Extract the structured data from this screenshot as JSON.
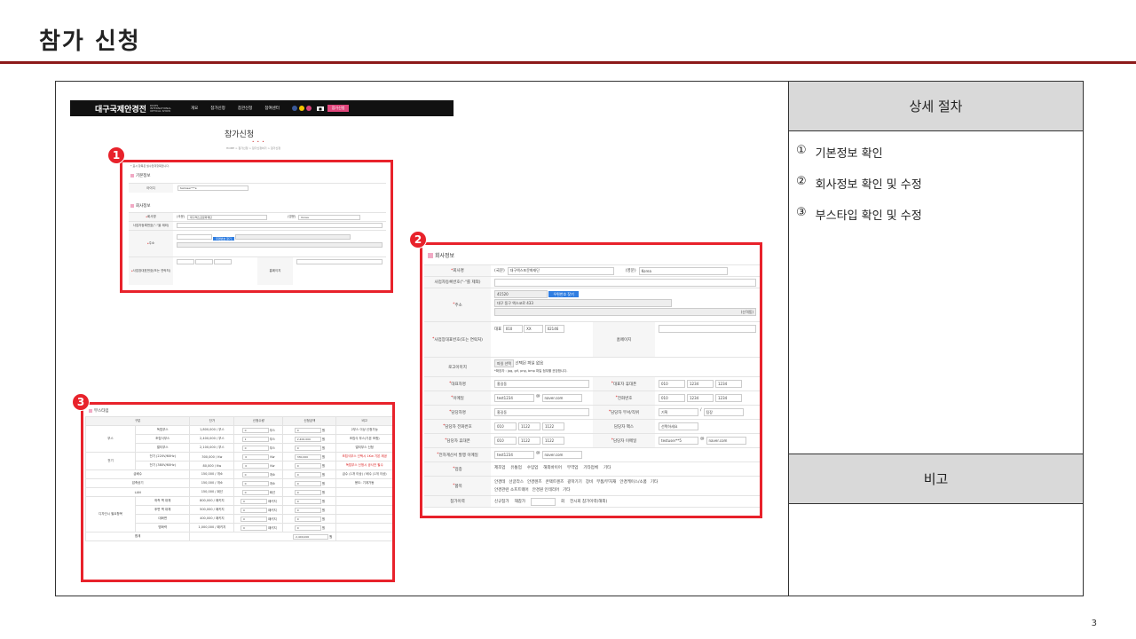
{
  "slide": {
    "title": "참가 신청",
    "page_number": "3"
  },
  "side": {
    "header": "상세 절차",
    "steps": [
      {
        "num": "①",
        "text": "기본정보 확인"
      },
      {
        "num": "②",
        "text": "회사정보 확인 및 수정"
      },
      {
        "num": "③",
        "text": "부스타입 확인 및 수정"
      }
    ],
    "notes_header": "비고"
  },
  "badges": [
    "1",
    "2",
    "3"
  ],
  "site": {
    "logo": "대구국제안경전",
    "logo_sub": "DIOPS INTERNATIONAL OPTICAL SHOW",
    "nav": [
      "개요",
      "참가신청",
      "참관신청",
      "참여센터"
    ],
    "cta": "참가신청",
    "page_heading": "참가신청",
    "dots": "• • •",
    "breadcrumb": "HOME > 참가신청 > 참가신청하기 > 참가신청",
    "note": "* 표시 항목은 필수입력항목입니다."
  },
  "form1": {
    "basic_title": "기본정보",
    "id_label": "아이디",
    "id_value": "testuser***e",
    "company_title": "회사정보",
    "company_label": "회사명",
    "company_ko_prefix": "(국문)",
    "company_ko": "대구엑스포문화재단",
    "company_en_prefix": "(영문)",
    "company_en": "Korea",
    "biz_label": "사업자등록번호(\"-\"을 제외)",
    "addr_label": "주소",
    "addr_btn": "우편번호 찾기",
    "contact_label": "사업장대표번호(또는 연락처)",
    "fax_label": "홈페이지"
  },
  "form2": {
    "title": "회사정보",
    "rows": {
      "company": "회사명",
      "company_ko_prefix": "(국문)",
      "company_ko": "대구엑스포문화재단",
      "company_en_prefix": "(영문)",
      "company_en": "Korea",
      "biz": "사업자등록번호(\"-\"를 제외)",
      "addr": "주소",
      "zip": "41520",
      "addr_btn": "우편번호 찾기",
      "addr1": "대구 동구 엑스코로 433",
      "addr_detail": "(산격동)",
      "contact": "사업장대표번호(또는 연락처)",
      "contact_mobile": "대표",
      "contact_v1": "010",
      "contact_v2": "XX",
      "contact_v3": "02146",
      "homepage": "홈페이지",
      "logo": "로고이미지",
      "logo_btn": "파일 선택",
      "logo_file": "선택된 파일 없음",
      "logo_note": "*확장자 : jpg, gif, png, bmp 파일 첨부를 권장합니다.",
      "ceo": "대표자명",
      "ceo_value": "홍길동",
      "ceo_phone": "대표자 휴대폰",
      "ceo_phone_v": [
        "010",
        "1234",
        "1234"
      ],
      "email": "이메일",
      "email_id": "test1234",
      "email_domain": "naver.com",
      "tel": "전화번호",
      "tel_v": [
        "010",
        "1234",
        "1234"
      ],
      "manager": "담당자명",
      "manager_v": "홍길동",
      "manager_dept": "담당자 부서/직위",
      "manager_dept_v": [
        "기획",
        "팀장"
      ],
      "manager_tel": "담당자 전화번호",
      "manager_tel_v": [
        "010",
        "1122",
        "1122"
      ],
      "manager_fax": "담당자 팩스",
      "manager_fax_v": "선택하세요",
      "manager_mobile": "담당자 휴대폰",
      "manager_mobile_v": [
        "010",
        "1122",
        "1122"
      ],
      "manager_email": "담당자 이메일",
      "manager_email_id": "testuser**5",
      "manager_email_domain": "naver.com",
      "tax_email": "전자계산서 발행 이메일",
      "tax_email_id": "test1234",
      "tax_email_domain": "naver.com",
      "category": "업종",
      "category_opts": [
        "제조업",
        "유통업",
        "수입업",
        "해외바이어",
        "무역업",
        "기타업체",
        "기타"
      ],
      "items": "품목",
      "items_opts": [
        "안경테",
        "선글라스",
        "안경렌즈",
        "콘택트렌즈",
        "광학기기",
        "장비",
        "부품/부자재",
        "안경케이스/소품",
        "기타"
      ],
      "items_opts2": [
        "안경관련 소프트웨어",
        "안경원 인테리어",
        "기타"
      ],
      "exhibit": "참가이력",
      "exhibit_opts": [
        "신규참가",
        "재참가",
        "회",
        "전시회 참가이력(해외)"
      ]
    }
  },
  "booth": {
    "title": "부스타입",
    "headers": [
      "구분",
      "단가",
      "신청수량",
      "신청금액",
      "비고"
    ],
    "rows": [
      {
        "group": "부스",
        "name": "독립부스",
        "price": "1,800,000 / 부스",
        "qty": "0",
        "unit": "부스",
        "amount": "0",
        "note": "2부스 이상 신청가능"
      },
      {
        "group": "",
        "name": "조립식부스",
        "price": "2,400,000 / 부스",
        "qty": "1",
        "unit": "부스",
        "amount": "2,400,000",
        "note": "조립식 부스(기본 포함)"
      },
      {
        "group": "",
        "name": "멀티부스",
        "price": "2,100,000 / 부스",
        "qty": "0",
        "unit": "부스",
        "amount": "0",
        "note": "멀티부스 신청"
      },
      {
        "group": "전기",
        "name": "전기 (220V/60Hz)",
        "price": "300,000 / Kw",
        "qty": "0",
        "unit": "Kw",
        "amount": "330,000",
        "note": "조립식부스 선택시 1Kw 기본 제공"
      },
      {
        "group": "",
        "name": "전기 (380V/60Hz)",
        "price": "80,000 / Kw",
        "qty": "0",
        "unit": "Kw",
        "amount": "0",
        "note": "독립부스 신청시 공사전 필수"
      },
      {
        "group": "",
        "name": "급배수",
        "price": "150,000 / 개소",
        "qty": "0",
        "unit": "개소",
        "amount": "0",
        "note": "급수 (1개 이상) / 배수 (1개 이상)"
      },
      {
        "group": "",
        "name": "압축공기",
        "price": "150,000 / 개소",
        "qty": "0",
        "unit": "개소",
        "amount": "0",
        "note": "용도: 기계가동"
      },
      {
        "group": "",
        "name": "LAN",
        "price": "150,000 / 회선",
        "qty": "0",
        "unit": "회선",
        "amount": "0",
        "note": ""
      },
      {
        "group": "디자인시 필요항목",
        "name": "좌측 벽 대체",
        "price": "800,000 / 패키지",
        "qty": "0",
        "unit": "패키지",
        "amount": "0",
        "note": ""
      },
      {
        "group": "",
        "name": "후면 벽 대체",
        "price": "500,000 / 패키지",
        "qty": "0",
        "unit": "패키지",
        "amount": "0",
        "note": ""
      },
      {
        "group": "",
        "name": "대화면",
        "price": "400,000 / 패키지",
        "qty": "0",
        "unit": "패키지",
        "amount": "0",
        "note": ""
      },
      {
        "group": "",
        "name": "명화력",
        "price": "1,000,000 / 패키지",
        "qty": "0",
        "unit": "패키지",
        "amount": "0",
        "note": ""
      }
    ],
    "total_label": "합계",
    "total_value": "2,400,000",
    "total_unit": "원",
    "won": "원"
  },
  "colors": {
    "accent": "#e8222b",
    "rule": "#8c1a1a",
    "side_header": "#d9d9d9"
  }
}
